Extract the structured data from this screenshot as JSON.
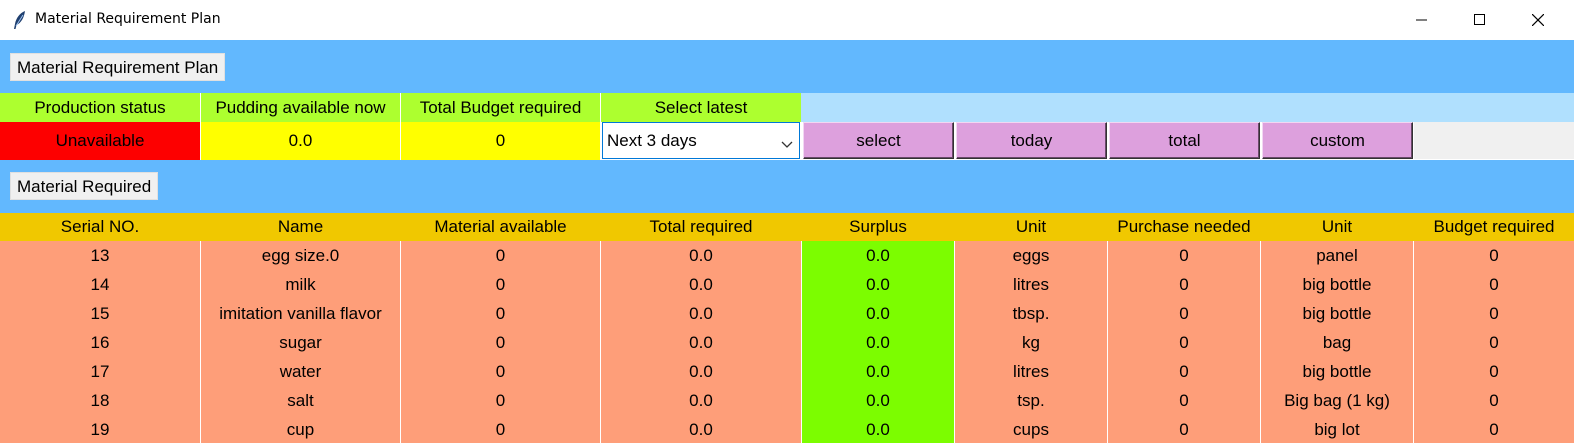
{
  "window": {
    "title": "Material Requirement Plan",
    "app_icon": "feather-icon"
  },
  "header_label": "Material Requirement Plan",
  "status": {
    "headers": [
      "Production status",
      "Pudding available now",
      "Total Budget required",
      "Select latest"
    ],
    "production_status": "Unavailable",
    "pudding_available": "0.0",
    "total_budget": "0",
    "select_value": "Next 3 days",
    "buttons": [
      "select",
      "today",
      "total",
      "custom"
    ]
  },
  "material_label": "Material Required",
  "table": {
    "columns": [
      "Serial NO.",
      "Name",
      "Material available",
      "Total required",
      "Surplus",
      "Unit",
      "Purchase needed",
      "Unit",
      "Budget required"
    ],
    "rows": [
      [
        "13",
        "egg size.0",
        "0",
        "0.0",
        "0.0",
        "eggs",
        "0",
        "panel",
        "0"
      ],
      [
        "14",
        "milk",
        "0",
        "0.0",
        "0.0",
        "litres",
        "0",
        "big bottle",
        "0"
      ],
      [
        "15",
        "imitation vanilla flavor",
        "0",
        "0.0",
        "0.0",
        "tbsp.",
        "0",
        "big bottle",
        "0"
      ],
      [
        "16",
        "sugar",
        "0",
        "0.0",
        "0.0",
        "kg",
        "0",
        "bag",
        "0"
      ],
      [
        "17",
        "water",
        "0",
        "0.0",
        "0.0",
        "litres",
        "0",
        "big bottle",
        "0"
      ],
      [
        "18",
        "salt",
        "0",
        "0.0",
        "0.0",
        "tsp.",
        "0",
        "Big bag (1 kg)",
        "0"
      ],
      [
        "19",
        "cup",
        "0",
        "0.0",
        "0.0",
        "cups",
        "0",
        "big lot",
        "0"
      ]
    ]
  },
  "colors": {
    "band_blue": "#62b8fe",
    "header_green": "#adff2f",
    "unavailable_red": "#fd0000",
    "value_yellow": "#ffff00",
    "button_plum": "#dda0dd",
    "table_header": "#f0c800",
    "row_salmon": "#fe9e79",
    "surplus_green": "#7cfd00"
  }
}
